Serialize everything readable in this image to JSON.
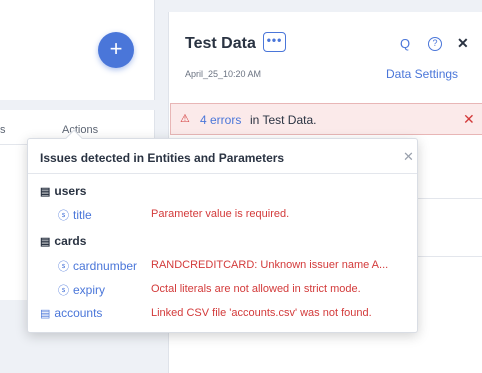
{
  "left": {
    "add_symbol": "+",
    "columns": {
      "partial": "s",
      "actions": "Actions"
    }
  },
  "right": {
    "title": "Test Data",
    "more_symbol": "•••",
    "date": "April_25_10:20 AM",
    "search_symbol": "Q",
    "help_symbol": "?",
    "close_symbol": "✕",
    "data_settings": "Data Settings",
    "errors": {
      "warning_symbol": "⚠",
      "count_text": "4 errors",
      "suffix_text": "in Test Data.",
      "close_symbol": "✕"
    }
  },
  "popup": {
    "title": "Issues detected in Entities and Parameters",
    "close_symbol": "✕",
    "entity_icon": "▤",
    "param_icon": "ⓢ",
    "rows": [
      {
        "label": "users",
        "message": ""
      },
      {
        "label": "title",
        "message": "Parameter value is required."
      },
      {
        "label": "cards",
        "message": ""
      },
      {
        "label": "cardnumber",
        "message": "RANDCREDITCARD: Unknown issuer name A..."
      },
      {
        "label": "expiry",
        "message": "Octal literals are not allowed in strict mode."
      },
      {
        "label": "accounts",
        "message": "Linked CSV file 'accounts.csv' was not found."
      }
    ]
  },
  "colors": {
    "accent": "#4a76d9",
    "error": "#d33a3a",
    "error_bg": "#fbeaea"
  }
}
